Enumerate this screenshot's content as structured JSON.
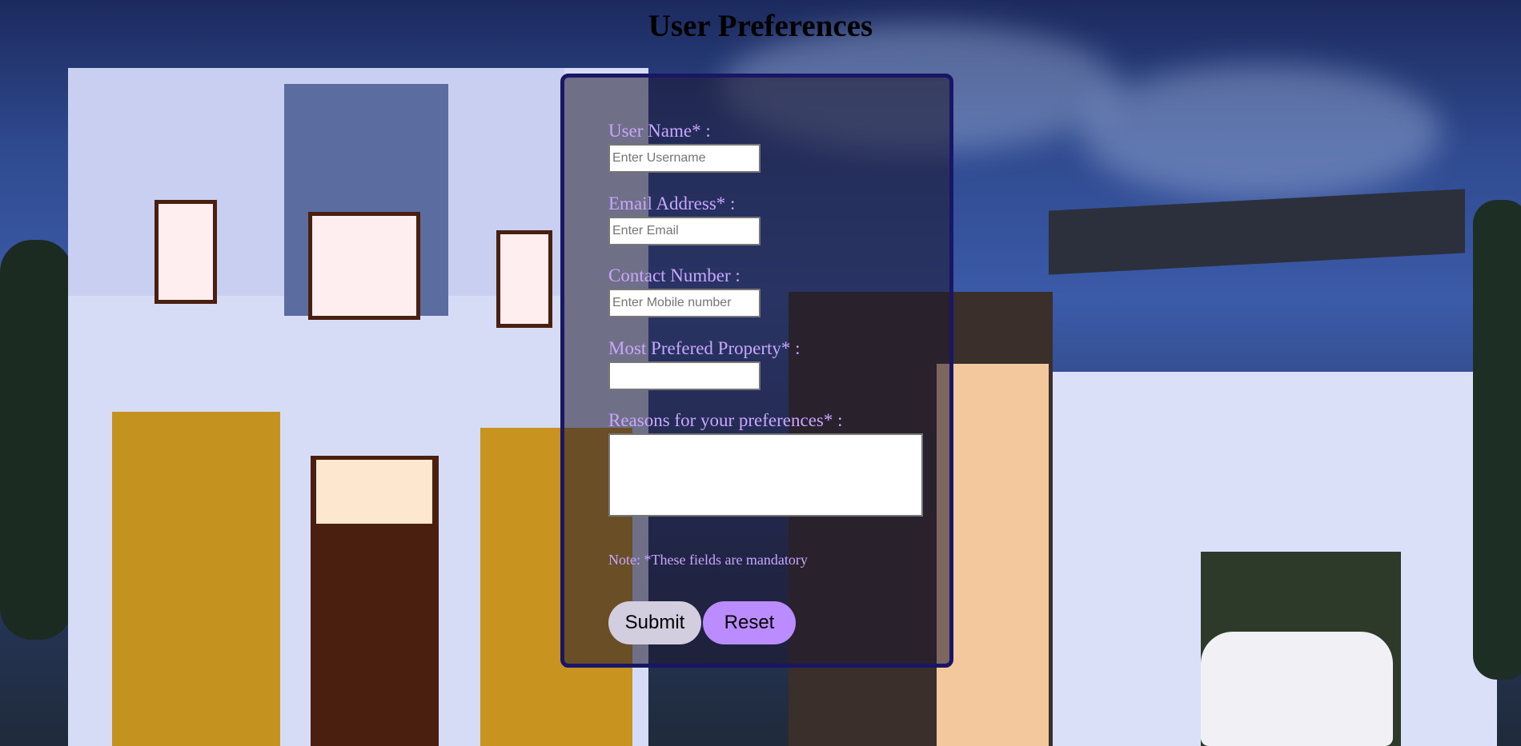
{
  "page": {
    "title": "User Preferences"
  },
  "form": {
    "username": {
      "label": "User Name* :",
      "placeholder": "Enter Username",
      "value": ""
    },
    "email": {
      "label": "Email Address* :",
      "placeholder": "Enter Email",
      "value": ""
    },
    "contact": {
      "label": "Contact Number :",
      "placeholder": "Enter Mobile number",
      "value": ""
    },
    "property": {
      "label": "Most Prefered Property* :",
      "placeholder": "",
      "value": ""
    },
    "reasons": {
      "label": "Reasons for your preferences* :",
      "value": ""
    },
    "note": "Note: *These fields are mandatory",
    "submit_label": "Submit",
    "reset_label": "Reset"
  },
  "colors": {
    "label_text": "#c9a6ff",
    "panel_border": "#1a1666",
    "submit_bg": "#d3cde0",
    "reset_bg": "#bb8cff"
  }
}
